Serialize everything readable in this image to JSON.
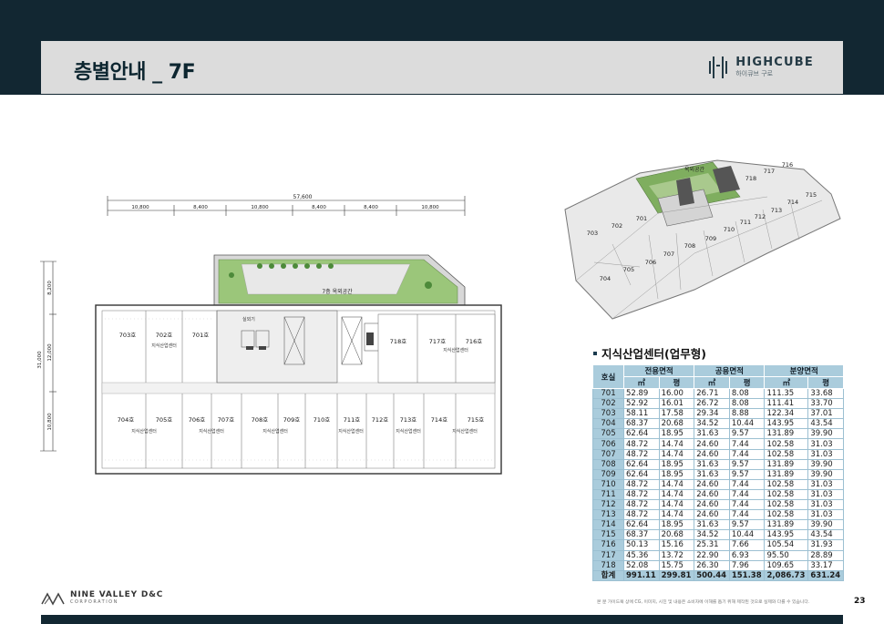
{
  "header": {
    "title": "층별안내 _ 7F"
  },
  "logo": {
    "main": "HIGHCUBE",
    "sub": "하이큐브 구로"
  },
  "plan": {
    "total_width": "57,600",
    "segments": [
      "10,800",
      "8,400",
      "10,800",
      "8,400",
      "8,400",
      "10,800"
    ],
    "vertical": [
      "8,200",
      "12,000",
      "10,800"
    ],
    "vertical_total": "31,000",
    "outdoor_label": "7층 옥외공간",
    "lounge_label": "실외기",
    "top_units": [
      "703호",
      "702호",
      "701호",
      "718호",
      "717호",
      "716호"
    ],
    "bottom_units": [
      "704호",
      "705호",
      "706호",
      "707호",
      "708호",
      "709호",
      "710호",
      "711호",
      "712호",
      "713호",
      "714호",
      "715호"
    ],
    "usage_label": "지식산업센터"
  },
  "view3d": {
    "roof_label": "옥외공간",
    "units": [
      "701",
      "702",
      "703",
      "704",
      "705",
      "706",
      "707",
      "708",
      "709",
      "710",
      "711",
      "712",
      "713",
      "714",
      "715",
      "716",
      "717",
      "718"
    ]
  },
  "table": {
    "heading": "지식산업센터(업무형)",
    "headers": {
      "ho": "호실",
      "exclusive": "전용면적",
      "common": "공용면적",
      "sale": "분양면적",
      "sqm": "㎡",
      "pyeong": "평"
    },
    "rows": [
      [
        "701",
        "52.89",
        "16.00",
        "26.71",
        "8.08",
        "111.35",
        "33.68"
      ],
      [
        "702",
        "52.92",
        "16.01",
        "26.72",
        "8.08",
        "111.41",
        "33.70"
      ],
      [
        "703",
        "58.11",
        "17.58",
        "29.34",
        "8.88",
        "122.34",
        "37.01"
      ],
      [
        "704",
        "68.37",
        "20.68",
        "34.52",
        "10.44",
        "143.95",
        "43.54"
      ],
      [
        "705",
        "62.64",
        "18.95",
        "31.63",
        "9.57",
        "131.89",
        "39.90"
      ],
      [
        "706",
        "48.72",
        "14.74",
        "24.60",
        "7.44",
        "102.58",
        "31.03"
      ],
      [
        "707",
        "48.72",
        "14.74",
        "24.60",
        "7.44",
        "102.58",
        "31.03"
      ],
      [
        "708",
        "62.64",
        "18.95",
        "31.63",
        "9.57",
        "131.89",
        "39.90"
      ],
      [
        "709",
        "62.64",
        "18.95",
        "31.63",
        "9.57",
        "131.89",
        "39.90"
      ],
      [
        "710",
        "48.72",
        "14.74",
        "24.60",
        "7.44",
        "102.58",
        "31.03"
      ],
      [
        "711",
        "48.72",
        "14.74",
        "24.60",
        "7.44",
        "102.58",
        "31.03"
      ],
      [
        "712",
        "48.72",
        "14.74",
        "24.60",
        "7.44",
        "102.58",
        "31.03"
      ],
      [
        "713",
        "48.72",
        "14.74",
        "24.60",
        "7.44",
        "102.58",
        "31.03"
      ],
      [
        "714",
        "62.64",
        "18.95",
        "31.63",
        "9.57",
        "131.89",
        "39.90"
      ],
      [
        "715",
        "68.37",
        "20.68",
        "34.52",
        "10.44",
        "143.95",
        "43.54"
      ],
      [
        "716",
        "50.13",
        "15.16",
        "25.31",
        "7.66",
        "105.54",
        "31.93"
      ],
      [
        "717",
        "45.36",
        "13.72",
        "22.90",
        "6.93",
        "95.50",
        "28.89"
      ],
      [
        "718",
        "52.08",
        "15.75",
        "26.30",
        "7.96",
        "109.65",
        "33.17"
      ]
    ],
    "total": [
      "합계",
      "991.11",
      "299.81",
      "500.44",
      "151.38",
      "2,086.73",
      "631.24"
    ]
  },
  "footer": {
    "company": "NINE VALLEY D&C",
    "company_sub": "CORPORATION",
    "disclaimer": "본 분 가이드북 상에 CG, 이미지, 시진 및 내용은 소비자에 이해를 돕기 위해 제작된 것으로 실제와 다를 수 있습니다.",
    "page_number": "23"
  },
  "colors": {
    "navy": "#122732",
    "title_bar": "#dcdcdc",
    "table_header": "#aaccdc",
    "green": "#8fbf6a"
  }
}
